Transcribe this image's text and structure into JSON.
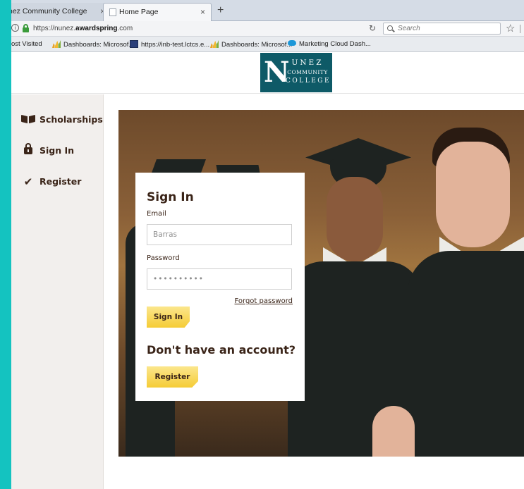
{
  "browser": {
    "tabs": [
      {
        "label": "nez Community College",
        "close": "×"
      },
      {
        "label": "Home Page",
        "close": "×"
      }
    ],
    "new_tab": "+",
    "url_prefix": "https://nunez.",
    "url_domain": "awardspring",
    "url_suffix": ".com",
    "search_placeholder": "Search",
    "bookmarks": [
      "ost Visited",
      "Dashboards: Microsof...",
      "https://inb-test.lctcs.e...",
      "Dashboards: Microsof...",
      "Marketing Cloud Dash..."
    ]
  },
  "logo": {
    "letter": "N",
    "line1": "UNEZ",
    "line2": "COMMUNITY",
    "line3": "COLLEGE",
    "color": "#0e5a67"
  },
  "sidebar": {
    "items": [
      {
        "label": "Scholarships",
        "icon": "book-icon"
      },
      {
        "label": "Sign In",
        "icon": "lock-icon"
      },
      {
        "label": "Register",
        "icon": "check-icon"
      }
    ]
  },
  "signin": {
    "title": "Sign In",
    "email_label": "Email",
    "email_value": "Barras",
    "password_label": "Password",
    "password_value": "••••••••••",
    "forgot_label": "Forgot password",
    "signin_button": "Sign In",
    "no_account": "Don't have an account?",
    "register_button": "Register"
  },
  "colors": {
    "accent_gold": "#f5cc36",
    "text_brown": "#3a2418",
    "frame_teal": "#14c3c0"
  }
}
